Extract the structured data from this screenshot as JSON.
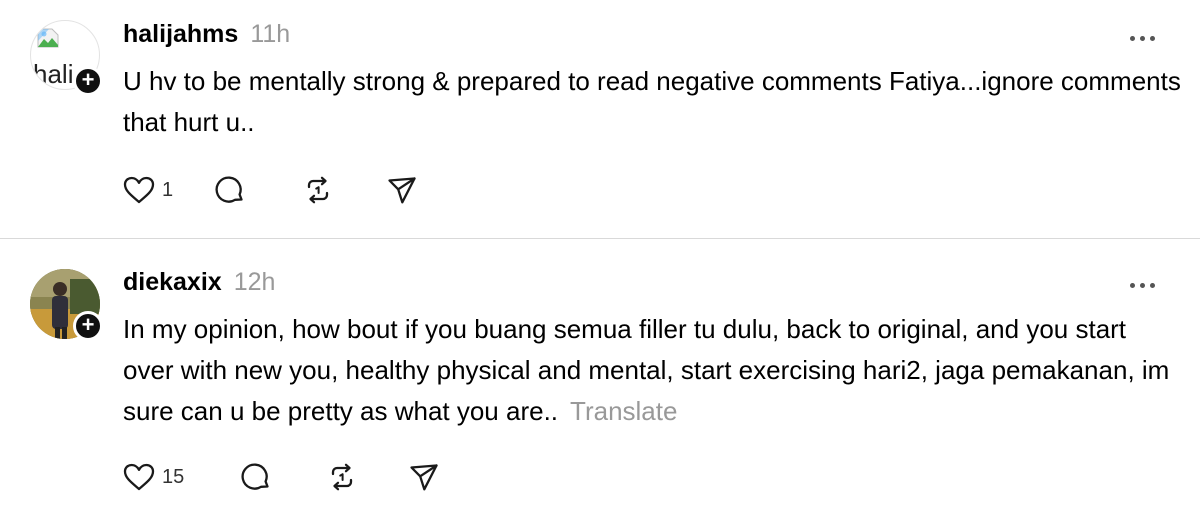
{
  "posts": [
    {
      "username": "halijahms",
      "time": "11h",
      "avatar_alt": "hali",
      "text": "U hv to be mentally strong & prepared to read negative comments Fatiya...ignore comments that hurt u..",
      "translate": "",
      "likes": "1"
    },
    {
      "username": "diekaxix",
      "time": "12h",
      "avatar_alt": "",
      "text": "In my opinion, how bout if you buang semua filler tu dulu, back to original, and you start over with new you, healthy physical and mental, start exercising hari2, jaga pemakanan, im sure can u be pretty as what you are..",
      "translate": "Translate",
      "likes": "15"
    }
  ],
  "icons": {
    "like": "heart-icon",
    "reply": "comment-icon",
    "repost": "repost-icon",
    "share": "send-icon",
    "more": "more-icon",
    "follow": "plus-icon"
  },
  "colors": {
    "text": "#000000",
    "muted": "#999999",
    "divider": "#d9d9d9",
    "badge": "#101010"
  }
}
